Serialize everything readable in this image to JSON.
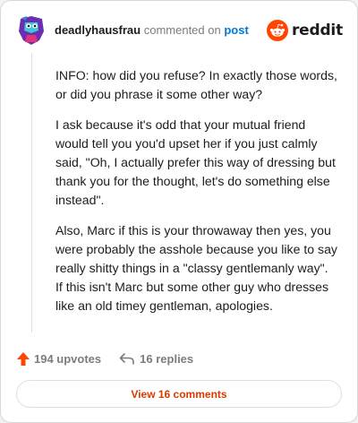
{
  "comment": {
    "username": "deadlyhausfrau",
    "action_text": "commented on",
    "post_link_label": "post",
    "paragraphs": [
      "INFO: how did you refuse? In exactly those words, or did you phrase it some other way?",
      "I ask because it's odd that your mutual friend would tell you you'd upset her if you just calmly said, \"Oh, I actually prefer this way of dressing but thank you for the thought, let's do something else instead\".",
      "Also, Marc if this is your throwaway then yes, you were probably the asshole because you like to say really shitty things in a \"classy gentlemanly way\". If this isn't Marc but some other guy who dresses like an old timey gentleman, apologies."
    ],
    "upvotes_label": "194 upvotes",
    "replies_label": "16 replies",
    "view_comments_label": "View 16 comments"
  },
  "brand": {
    "wordmark": "reddit",
    "logo_icon": "reddit-snoo-icon",
    "accent_color": "#ff4500"
  },
  "icons": {
    "upvote": "upvote-arrow-icon",
    "reply": "reply-arrow-icon",
    "avatar": "user-avatar"
  },
  "colors": {
    "link": "#0079d3",
    "upvote": "#ff4500",
    "view_button_text": "#d93a00",
    "muted": "#7c7c7c"
  }
}
